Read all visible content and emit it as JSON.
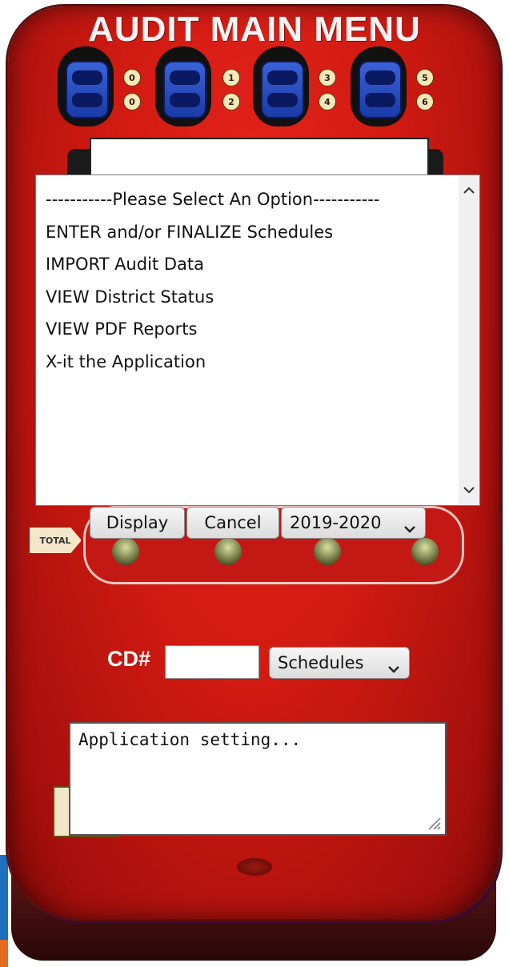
{
  "title": "AUDIT MAIN MENU",
  "slots": [
    {
      "badges": [
        "0",
        "0"
      ]
    },
    {
      "badges": [
        "1",
        "2"
      ]
    },
    {
      "badges": [
        "3",
        "4"
      ]
    },
    {
      "badges": [
        "5",
        "6"
      ]
    }
  ],
  "menu": {
    "options": [
      "-----------Please Select An Option-----------",
      "ENTER and/or FINALIZE Schedules",
      "IMPORT Audit Data",
      "VIEW District Status",
      "VIEW PDF Reports",
      "X-it the Application"
    ]
  },
  "total_label": "TOTAL",
  "buttons": {
    "display": "Display",
    "cancel": "Cancel"
  },
  "year_select": {
    "value": "2019-2020"
  },
  "cd": {
    "label": "CD#",
    "value": "",
    "type_select": "Schedules"
  },
  "status_text": "Application setting...",
  "colors": {
    "device_red": "#d01a12",
    "slot_blue": "#2a4fc8"
  }
}
